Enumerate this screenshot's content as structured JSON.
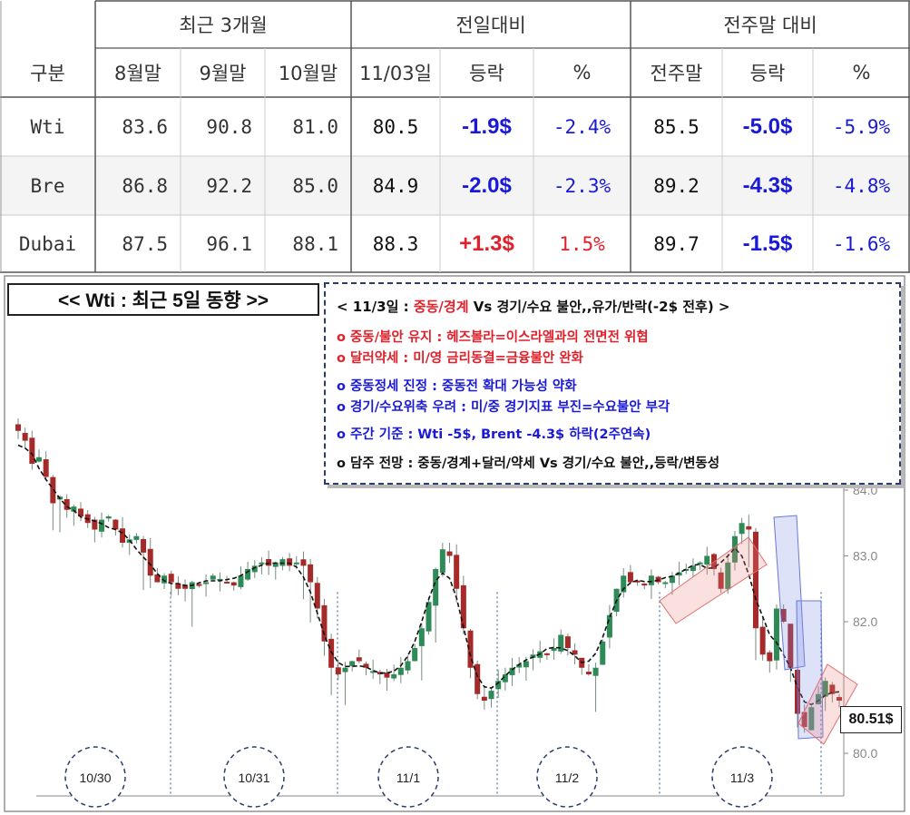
{
  "table": {
    "group_headers": {
      "recent": "최근 3개월",
      "daily": "전일대비",
      "weekly": "전주말 대비"
    },
    "col_headers": [
      "구분",
      "8월말",
      "9월말",
      "10월말",
      "11/03일",
      "등락",
      "%",
      "전주말",
      "등락",
      "%"
    ],
    "rows": [
      {
        "name": "Wti",
        "aug": "83.6",
        "sep": "90.8",
        "oct": "81.0",
        "nov03": "80.5",
        "d_chg": "-1.9$",
        "d_pct": "-2.4%",
        "prev_wk": "85.5",
        "w_chg": "-5.0$",
        "w_pct": "-5.9%"
      },
      {
        "name": "Bre",
        "aug": "86.8",
        "sep": "92.2",
        "oct": "85.0",
        "nov03": "84.9",
        "d_chg": "-2.0$",
        "d_pct": "-2.3%",
        "prev_wk": "89.2",
        "w_chg": "-4.3$",
        "w_pct": "-4.8%"
      },
      {
        "name": "Dubai",
        "aug": "87.5",
        "sep": "96.1",
        "oct": "88.1",
        "nov03": "88.3",
        "d_chg": "+1.3$",
        "d_pct": "1.5%",
        "prev_wk": "89.7",
        "w_chg": "-1.5$",
        "w_pct": "-1.6%"
      }
    ],
    "colors": {
      "up": "#e0202a",
      "down": "#1a1ad6"
    }
  },
  "chart_title": "<< Wti : 최근 5일 동향 >>",
  "news": {
    "headline_prefix": "< 11/3일 : ",
    "headline_red": "중동/경계",
    "headline_rest": " Vs 경기/수요 불안,,유가/반락(-2$ 전후) >",
    "lines": [
      "o 중동/불안 유지 : 헤즈볼라=이스라엘과의 전면전 위협",
      "o 달러약세 : 미/영 금리동결=금융불안 완화",
      "o 중동정세 진정 : 중동전 확대 가능성 약화",
      "o 경기/수요위축 우려 : 미/중 경기지표 부진=수요불안 부각",
      "o 주간 기준 : Wti -5$, Brent -4.3$ 하락(2주연속)",
      "o 담주 전망 : 중동/경계+달러/약세 Vs 경기/수요 불안,,등락/변동성"
    ],
    "line_colors": [
      "#e0202a",
      "#e0202a",
      "#1a1ad6",
      "#1a1ad6",
      "#1a1ad6",
      "#111111"
    ]
  },
  "last_price_label": "80.51$",
  "chart_data": {
    "type": "candlestick",
    "y_ticks": [
      "84.0",
      "83.0",
      "82.0",
      "80.0"
    ],
    "day_labels": [
      "10/30",
      "10/31",
      "11/1",
      "11/2",
      "11/3"
    ],
    "ylim": [
      79.7,
      85.3
    ],
    "colors": {
      "up": "#2e8b57",
      "down": "#a52a2a",
      "ma": "#111111"
    },
    "close_path": [
      84.9,
      84.75,
      84.4,
      84.5,
      84.2,
      83.8,
      83.9,
      83.7,
      83.75,
      83.6,
      83.5,
      83.4,
      83.55,
      83.6,
      83.4,
      83.2,
      83.25,
      83.3,
      83.05,
      82.7,
      82.6,
      82.7,
      82.6,
      82.5,
      82.5,
      82.6,
      82.55,
      82.6,
      82.7,
      82.65,
      82.6,
      82.55,
      82.7,
      82.8,
      82.85,
      82.9,
      82.85,
      82.9,
      82.95,
      82.85,
      82.9,
      82.85,
      82.6,
      82.2,
      81.7,
      81.3,
      81.2,
      81.3,
      81.4,
      81.4,
      81.3,
      81.25,
      81.2,
      81.15,
      81.2,
      81.3,
      81.4,
      81.6,
      81.9,
      82.3,
      82.8,
      83.1,
      83.0,
      82.5,
      81.9,
      81.3,
      80.9,
      80.8,
      80.95,
      81.1,
      81.2,
      81.3,
      81.35,
      81.4,
      81.5,
      81.55,
      81.5,
      81.6,
      81.8,
      81.6,
      81.5,
      81.3,
      81.2,
      81.3,
      81.7,
      82.1,
      82.5,
      82.7,
      82.6,
      82.6,
      82.55,
      82.7,
      82.6,
      82.6,
      82.7,
      82.75,
      82.8,
      82.85,
      82.9,
      83.0,
      82.8,
      82.5,
      82.9,
      83.3,
      83.5,
      83.4,
      81.9,
      81.5,
      81.4,
      82.2,
      82.0,
      81.3,
      80.6,
      80.4,
      80.7,
      80.9,
      81.1,
      80.9,
      80.8
    ]
  }
}
